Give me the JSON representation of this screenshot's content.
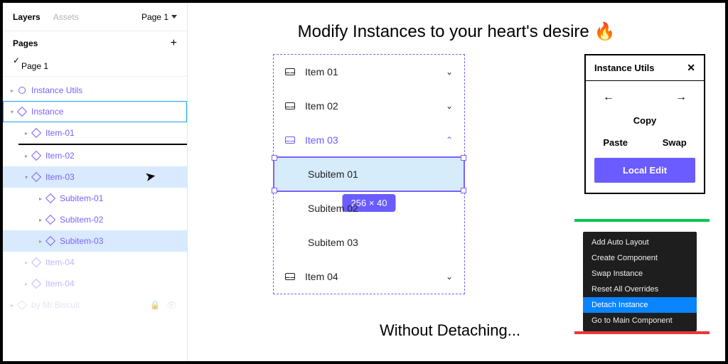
{
  "tabs": {
    "layers": "Layers",
    "assets": "Assets",
    "page_sel": "Page 1"
  },
  "pages_header": "Pages",
  "current_page": "Page 1",
  "tree": {
    "n0": "Instance Utils",
    "n1": "Instance",
    "n2": "Item-01",
    "n3": "Item-02",
    "n4": "Item-03",
    "n5": "Subitem-01",
    "n6": "Subitem-02",
    "n7": "Subitem-03",
    "n8": "Item-04",
    "n9": "Item-04",
    "footer": "by Mr.Biscuit"
  },
  "headline": "Modify Instances to your heart's desire 🔥",
  "footline": "Without Detaching...",
  "menu": {
    "i1": "Item 01",
    "i2": "Item 02",
    "i3": "Item 03",
    "s1": "Subitem 01",
    "s2": "Subitem 02",
    "s3": "Subitem 03",
    "i4": "Item 04",
    "size": "256 × 40"
  },
  "plugin": {
    "title": "Instance Utils",
    "copy": "Copy",
    "paste": "Paste",
    "swap": "Swap",
    "local": "Local Edit"
  },
  "ctx": {
    "a": "Add Auto Layout",
    "b": "Create Component",
    "c": "Swap Instance",
    "d": "Reset All Overrides",
    "e": "Detach Instance",
    "f": "Go to Main Component"
  }
}
